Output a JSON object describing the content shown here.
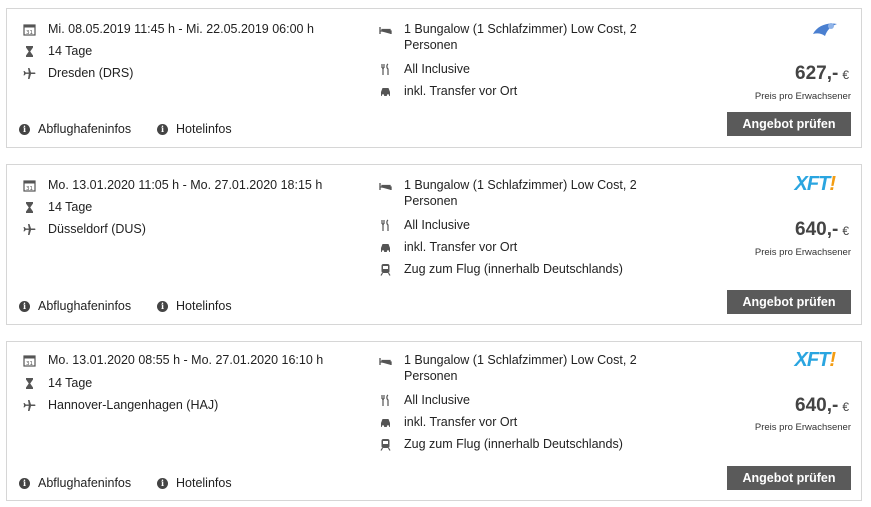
{
  "offers": [
    {
      "dates": "Mi. 08.05.2019 11:45 h - Mi. 22.05.2019 06:00 h",
      "duration": "14 Tage",
      "airport": "Dresden (DRS)",
      "room": "1 Bungalow (1 Schlafzimmer) Low Cost, 2 Personen",
      "board": "All Inclusive",
      "transfer": "inkl. Transfer vor Ort",
      "train": "",
      "price": "627,-",
      "currency": "€",
      "price_note": "Preis pro Erwachsener",
      "button": "Angebot prüfen",
      "airport_link": "Abflughafeninfos",
      "hotel_link": "Hotelinfos",
      "logo": "",
      "logo_icon": "tour-operator-logo-blue"
    },
    {
      "dates": "Mo. 13.01.2020 11:05 h - Mo. 27.01.2020 18:15 h",
      "duration": "14 Tage",
      "airport": "Düsseldorf (DUS)",
      "room": "1 Bungalow (1 Schlafzimmer) Low Cost, 2 Personen",
      "board": "All Inclusive",
      "transfer": "inkl. Transfer vor Ort",
      "train": "Zug zum Flug (innerhalb Deutschlands)",
      "price": "640,-",
      "currency": "€",
      "price_note": "Preis pro Erwachsener",
      "button": "Angebot prüfen",
      "airport_link": "Abflughafeninfos",
      "hotel_link": "Hotelinfos",
      "logo": "XFT!",
      "logo_icon": "xft-logo"
    },
    {
      "dates": "Mo. 13.01.2020 08:55 h - Mo. 27.01.2020 16:10 h",
      "duration": "14 Tage",
      "airport": "Hannover-Langenhagen (HAJ)",
      "room": "1 Bungalow (1 Schlafzimmer) Low Cost, 2 Personen",
      "board": "All Inclusive",
      "transfer": "inkl. Transfer vor Ort",
      "train": "Zug zum Flug (innerhalb Deutschlands)",
      "price": "640,-",
      "currency": "€",
      "price_note": "Preis pro Erwachsener",
      "button": "Angebot prüfen",
      "airport_link": "Abflughafeninfos",
      "hotel_link": "Hotelinfos",
      "logo": "XFT!",
      "logo_icon": "xft-logo"
    }
  ],
  "colors": {
    "button_bg": "#5a5a5a",
    "xft_blue": "#2aa5e0",
    "xft_orange": "#f39c12"
  }
}
